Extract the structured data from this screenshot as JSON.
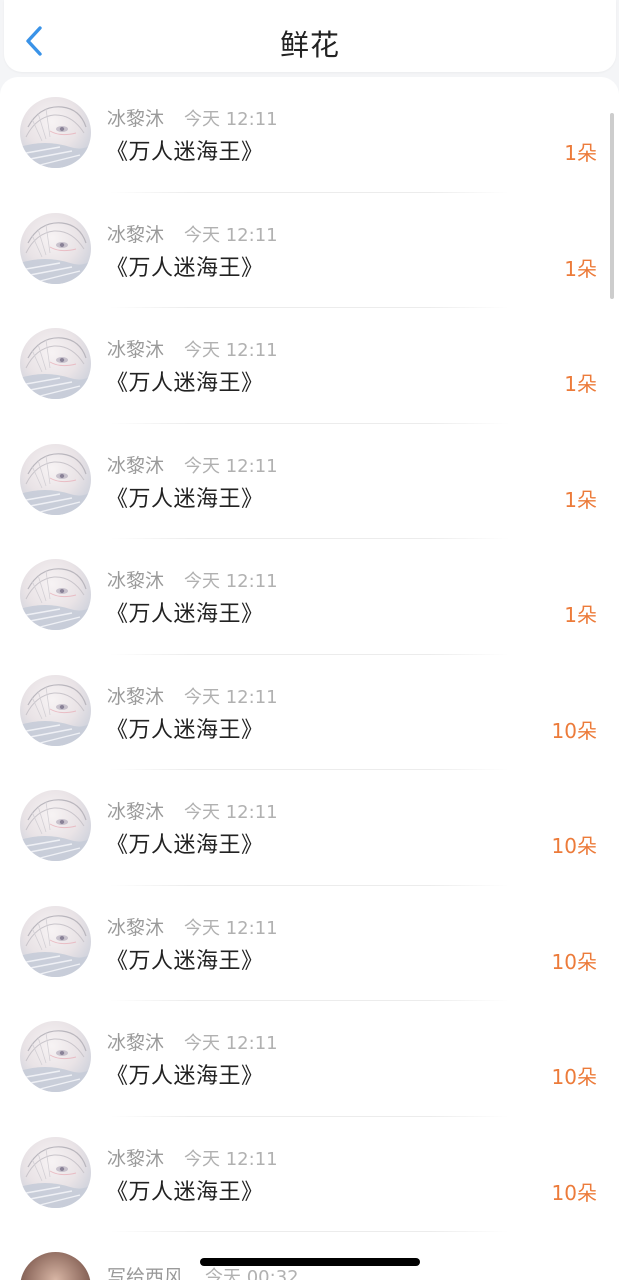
{
  "header": {
    "title": "鲜花",
    "back_icon": "chevron-left-icon",
    "accent_color": "#3a93e8"
  },
  "records": [
    {
      "name": "冰黎沐",
      "time": "今天 12:11",
      "book": "《万人迷海王》",
      "count": "1朵"
    },
    {
      "name": "冰黎沐",
      "time": "今天 12:11",
      "book": "《万人迷海王》",
      "count": "1朵"
    },
    {
      "name": "冰黎沐",
      "time": "今天 12:11",
      "book": "《万人迷海王》",
      "count": "1朵"
    },
    {
      "name": "冰黎沐",
      "time": "今天 12:11",
      "book": "《万人迷海王》",
      "count": "1朵"
    },
    {
      "name": "冰黎沐",
      "time": "今天 12:11",
      "book": "《万人迷海王》",
      "count": "1朵"
    },
    {
      "name": "冰黎沐",
      "time": "今天 12:11",
      "book": "《万人迷海王》",
      "count": "10朵"
    },
    {
      "name": "冰黎沐",
      "time": "今天 12:11",
      "book": "《万人迷海王》",
      "count": "10朵"
    },
    {
      "name": "冰黎沐",
      "time": "今天 12:11",
      "book": "《万人迷海王》",
      "count": "10朵"
    },
    {
      "name": "冰黎沐",
      "time": "今天 12:11",
      "book": "《万人迷海王》",
      "count": "10朵"
    },
    {
      "name": "冰黎沐",
      "time": "今天 12:11",
      "book": "《万人迷海王》",
      "count": "10朵"
    }
  ],
  "partial_record": {
    "name": "写给西风",
    "time": "今天 00:32"
  },
  "colors": {
    "count": "#ec7b3a",
    "name": "#9a9a9a",
    "book": "#222222"
  }
}
